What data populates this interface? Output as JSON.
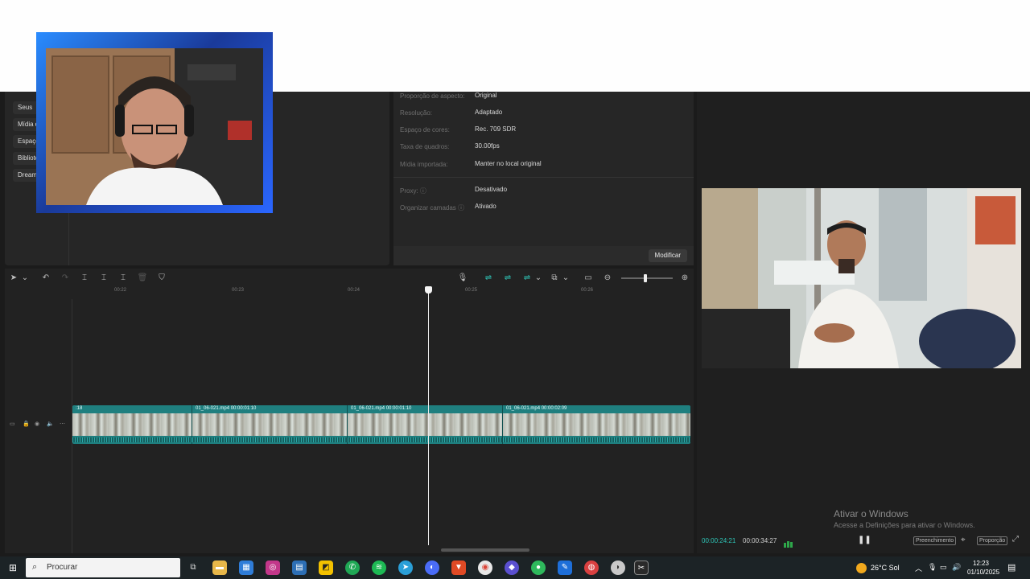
{
  "media_sidebar": {
    "items": [
      "Seus",
      "Mídia de",
      "Espaços",
      "Bibliotec",
      "Dreamin"
    ]
  },
  "properties": {
    "rows": [
      {
        "label": "Proporção de aspecto:",
        "value": "Original"
      },
      {
        "label": "Resolução:",
        "value": "Adaptado"
      },
      {
        "label": "Espaço de cores:",
        "value": "Rec. 709 SDR"
      },
      {
        "label": "Taxa de quadros:",
        "value": "30.00fps"
      },
      {
        "label": "Mídia importada:",
        "value": "Manter no local original"
      }
    ],
    "rows2": [
      {
        "label": "Proxy: ⓘ",
        "value": "Desativado"
      },
      {
        "label": "Organizar camadas ⓘ",
        "value": "Ativado"
      }
    ],
    "modify_label": "Modificar"
  },
  "timeline": {
    "ticks": [
      "00:22",
      "00:23",
      "00:24",
      "00:25",
      "00:26"
    ],
    "clips": [
      {
        "label": ":18"
      },
      {
        "label": "01_06-021.mp4   00:00:01:10"
      },
      {
        "label": "01_06-021.mp4   00:00:01:10"
      },
      {
        "label": "01_06-021.mp4   00:00:02:09"
      }
    ]
  },
  "viewer": {
    "time_current": "00:00:24:21",
    "time_total": "00:00:34:27",
    "fill_label": "Preenchimento",
    "ratio_label": "Proporção"
  },
  "watermark": {
    "title": "Ativar o Windows",
    "subtitle": "Acesse a Definições para ativar o Windows."
  },
  "taskbar": {
    "search_placeholder": "Procurar",
    "weather": "26°C  Sol",
    "time": "12:23",
    "date": "01/10/2025"
  }
}
